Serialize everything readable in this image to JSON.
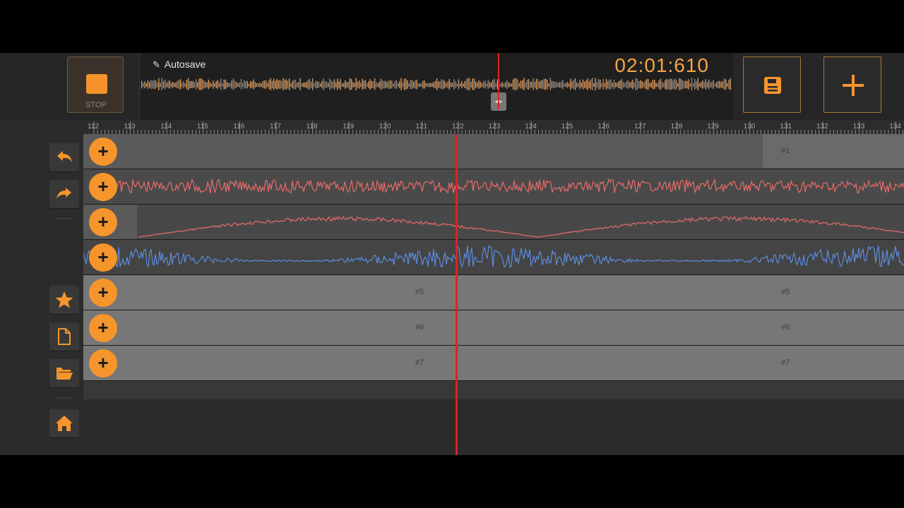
{
  "transport": {
    "stop_label": "STOP"
  },
  "header": {
    "autosave_label": "Autosave",
    "timecode": "02:01:610"
  },
  "toolbar": {
    "save_icon": "save-icon",
    "add_icon": "plus-icon"
  },
  "ruler": {
    "labels": [
      "112",
      "113",
      "114",
      "115",
      "116",
      "117",
      "118",
      "119",
      "120",
      "121",
      "122",
      "123",
      "124",
      "125",
      "126",
      "127",
      "128",
      "129",
      "130",
      "131",
      "132",
      "133",
      "134"
    ]
  },
  "sidebar": {
    "items": [
      "undo-icon",
      "redo-icon",
      "star-icon",
      "file-icon",
      "folder-open-icon",
      "home-icon"
    ]
  },
  "tracks": [
    {
      "id": 1,
      "label": "#1"
    },
    {
      "id": 2,
      "label": ""
    },
    {
      "id": 3,
      "label": ""
    },
    {
      "id": 4,
      "label": ""
    },
    {
      "id": 5,
      "label": "#5"
    },
    {
      "id": 6,
      "label": "#6"
    },
    {
      "id": 7,
      "label": "#7"
    }
  ],
  "colors": {
    "accent": "#f5952c",
    "timecode": "#f5a543",
    "playhead": "#e22020",
    "wave_red": "#e86b6b",
    "wave_blue": "#5b8de0"
  }
}
